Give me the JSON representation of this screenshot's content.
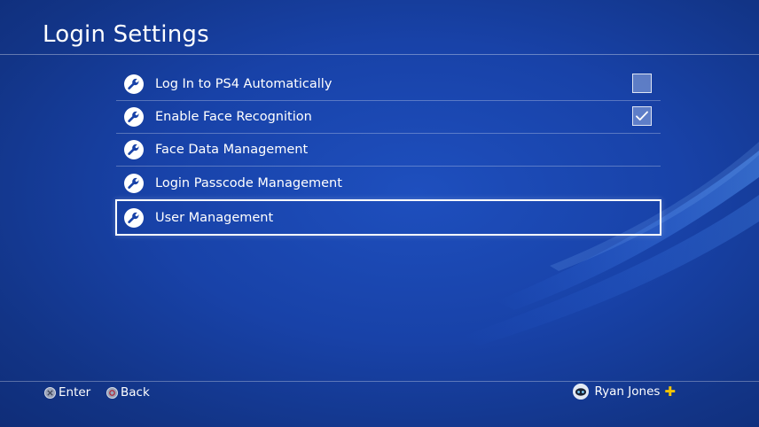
{
  "page": {
    "title": "Login Settings"
  },
  "menu": {
    "items": [
      {
        "label": "Log In to PS4 Automatically",
        "icon": "wrench-icon",
        "checkbox": true,
        "checked": false
      },
      {
        "label": "Enable Face Recognition",
        "icon": "wrench-icon",
        "checkbox": true,
        "checked": true
      },
      {
        "label": "Face Data Management",
        "icon": "wrench-icon",
        "checkbox": false
      },
      {
        "label": "Login Passcode Management",
        "icon": "wrench-icon",
        "checkbox": false
      },
      {
        "label": "User Management",
        "icon": "wrench-icon",
        "checkbox": false,
        "focused": true
      }
    ]
  },
  "footer": {
    "enter_label": "Enter",
    "enter_icon": "cross-button-icon",
    "back_label": "Back",
    "back_icon": "circle-button-icon",
    "user_name": "Ryan Jones",
    "user_icon": "avatar",
    "plus_icon": "playstation-plus-icon"
  },
  "colors": {
    "background": "#1842a8",
    "text": "#ffffff",
    "plus_accent": "#f5c400"
  }
}
